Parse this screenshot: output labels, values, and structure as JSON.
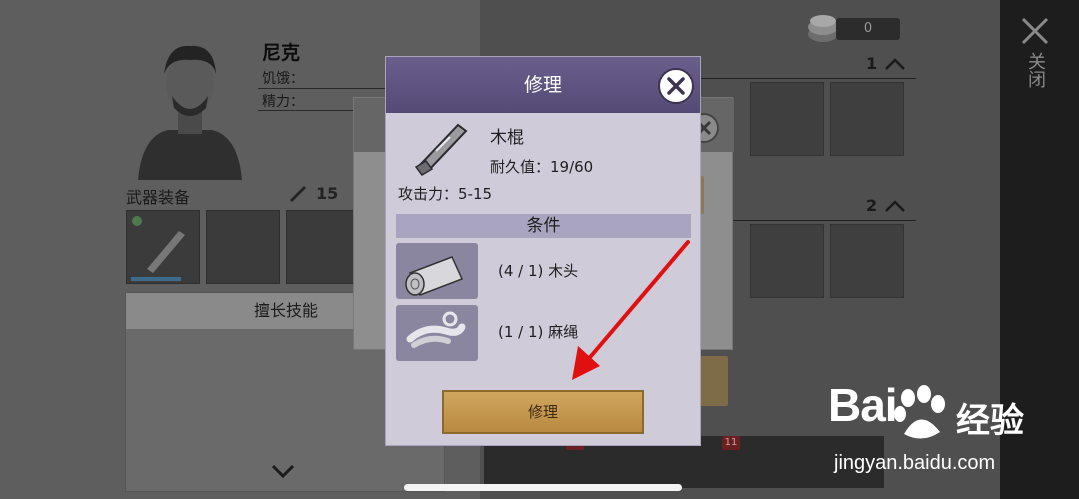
{
  "background": {
    "close_label": "关闭",
    "character": {
      "name": "尼克",
      "hunger_label": "饥饿：",
      "energy_label": "精力："
    },
    "weapons": {
      "title": "武器装备",
      "attack": "15"
    },
    "skills_title": "擅长技能",
    "coins": "0",
    "bag_rows": [
      "1",
      "2"
    ],
    "tab_badge": "11"
  },
  "dialog": {
    "title": "修理",
    "item_name": "木棍",
    "durability": "耐久值：19/60",
    "attack": "攻击力：5-15",
    "conditions_title": "条件",
    "materials": [
      {
        "text": "(4 / 1) 木头",
        "icon": "wood-log-icon"
      },
      {
        "text": "(1 / 1) 麻绳",
        "icon": "hemp-rope-icon"
      }
    ],
    "repair_button": "修理"
  },
  "watermark": {
    "logo": "Bai",
    "logo_cn": "经验",
    "url": "jingyan.baidu.com"
  },
  "colors": {
    "dialog_header": "#5e5380",
    "button": "#c49a4f",
    "arrow": "#e01010"
  }
}
